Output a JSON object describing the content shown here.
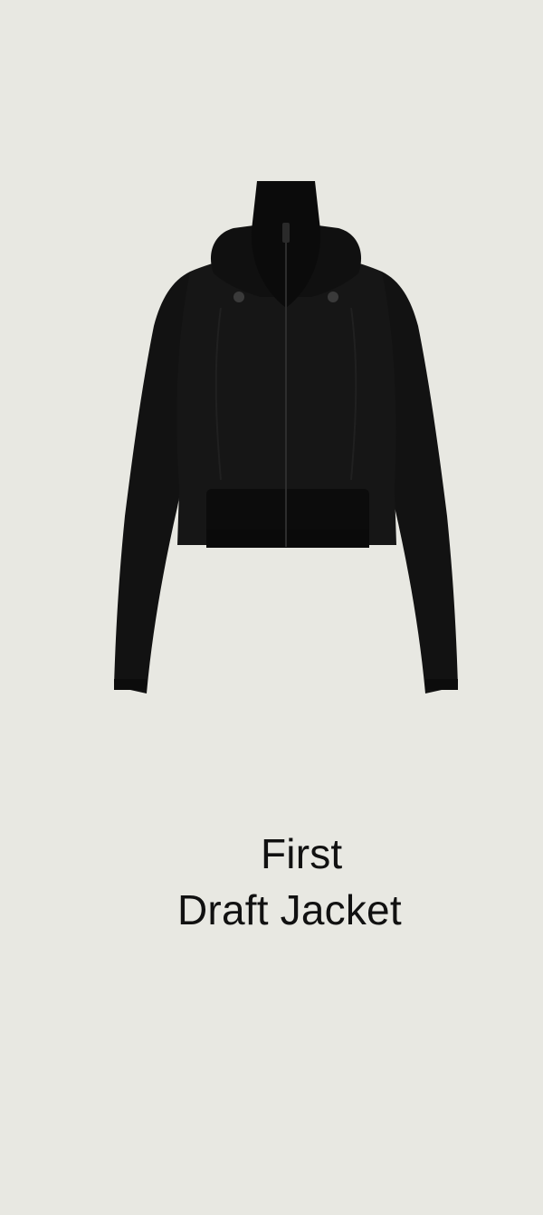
{
  "product": {
    "title_line1": "First",
    "title_line2": "Draft Jacket",
    "image_icon": "black-cropped-hooded-jacket",
    "colors": {
      "background": "#e8e8e2",
      "jacket": "#111111",
      "title_text": "#111111"
    }
  }
}
